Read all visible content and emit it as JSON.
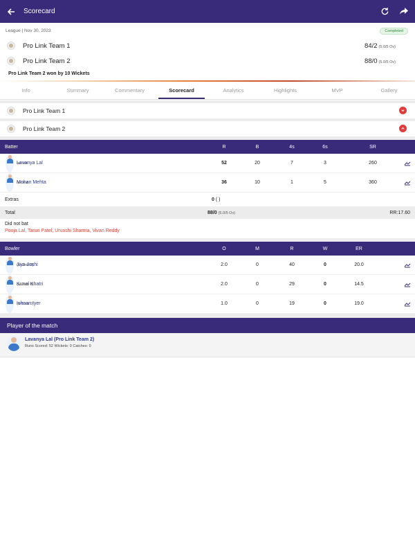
{
  "appbar": {
    "title": "Scorecard"
  },
  "match": {
    "meta": "League | Nov 30, 2023",
    "status": "Completed",
    "teams": [
      {
        "name": "Pro Link Team 1",
        "score": "84/2",
        "overs": "(5.0/5 Ov)"
      },
      {
        "name": "Pro Link Team 2",
        "score": "88/0",
        "overs": "(5.0/5 Ov)"
      }
    ],
    "result": "Pro Link Team 2 won by 10 Wickets"
  },
  "tabs": [
    "Info",
    "Summary",
    "Commentary",
    "Scorecard",
    "Analytics",
    "Highlights",
    "MVP",
    "Gallery"
  ],
  "active_tab": "Scorecard",
  "innings": [
    {
      "name": "Pro Link Team 1",
      "expanded": false
    },
    {
      "name": "Pro Link Team 2",
      "expanded": true
    }
  ],
  "batting": {
    "headers": {
      "player": "Batter",
      "r": "R",
      "b": "B",
      "fours": "4s",
      "sixes": "6s",
      "sr": "SR"
    },
    "rows": [
      {
        "name": "Lavanya Lal",
        "desc": "not out",
        "r": "52",
        "b": "20",
        "fours": "7",
        "sixes": "3",
        "sr": "260"
      },
      {
        "name": "Mohan Mehta",
        "desc": "not out",
        "r": "36",
        "b": "10",
        "fours": "1",
        "sixes": "5",
        "sr": "360"
      }
    ],
    "extras_label": "Extras",
    "extras_value": "0",
    "extras_detail": "( )",
    "total_label": "Total",
    "total_value": "88/0",
    "total_overs": "(5.0/5 Ov)",
    "run_rate": "RR:17.60",
    "dnb_label": "Did not bat",
    "dnb_list": "Pooja Lal, Tarun Patel, Urvashi Sharma, Vivan Reddy"
  },
  "bowling": {
    "headers": {
      "player": "Bowler",
      "o": "O",
      "m": "M",
      "r": "R",
      "w": "W",
      "er": "ER"
    },
    "rows": [
      {
        "name": "Jiya Joshi",
        "desc": "(w 0 nb 0)",
        "o": "2.0",
        "m": "0",
        "r": "40",
        "w": "0",
        "er": "20.0"
      },
      {
        "name": "Kunal Khatri",
        "desc": "(w 0 nb 0)",
        "o": "2.0",
        "m": "0",
        "r": "29",
        "w": "0",
        "er": "14.5"
      },
      {
        "name": "Ishaan Iyer",
        "desc": "(w 0 nb 0)",
        "o": "1.0",
        "m": "0",
        "r": "19",
        "w": "0",
        "er": "19.0"
      }
    ]
  },
  "player_of_match": {
    "heading": "Player of the match",
    "name": "Lavanya Lal (Pro Link Team 2)",
    "stats": "Runs Scored: 52   Wickets: 0   Catches: 0"
  },
  "colors": {
    "primary": "#3a2a7a",
    "accent_red": "#e23b3b",
    "dnb_red": "#e0453a",
    "completed_green": "#2e8b3a"
  }
}
